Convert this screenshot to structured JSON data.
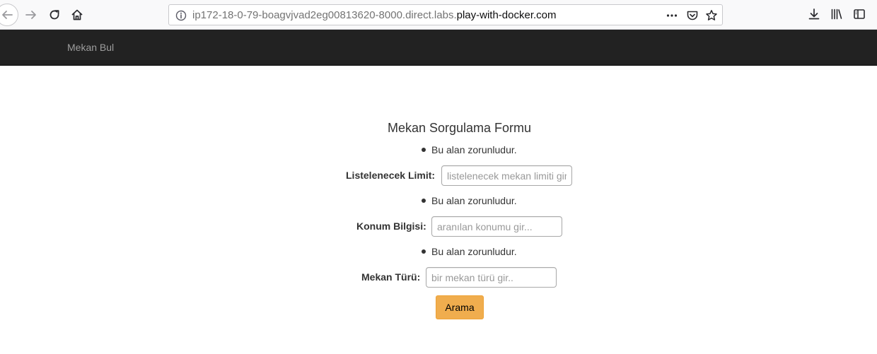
{
  "browser": {
    "url_prefix": "ip172-18-0-79-boagvjvad2eg00813620-8000.direct.labs.",
    "url_domain": "play-with-docker.com",
    "icons": {
      "back": "back-arrow-icon",
      "forward": "forward-arrow-icon",
      "reload": "reload-icon",
      "home": "home-icon",
      "site_info": "info-icon",
      "page_actions": "more-horizontal-icon",
      "pocket": "pocket-icon",
      "bookmark": "star-icon",
      "downloads": "download-icon",
      "library": "library-icon",
      "sidebar": "sidebar-icon"
    }
  },
  "navbar": {
    "brand": "Mekan Bul",
    "background_color": "#222222",
    "brand_color": "#9d9d9d"
  },
  "form": {
    "title": "Mekan Sorgulama Formu",
    "fields": [
      {
        "error": "Bu alan zorunludur.",
        "label": "Listelenecek Limit:",
        "placeholder": "listelenecek mekan limiti gir...",
        "value": ""
      },
      {
        "error": "Bu alan zorunludur.",
        "label": "Konum Bilgisi:",
        "placeholder": "aranılan konumu gir...",
        "value": ""
      },
      {
        "error": "Bu alan zorunludur.",
        "label": "Mekan Türü:",
        "placeholder": "bir mekan türü gir..",
        "value": ""
      }
    ],
    "submit_label": "Arama",
    "submit_color": "#f0ad4e"
  }
}
